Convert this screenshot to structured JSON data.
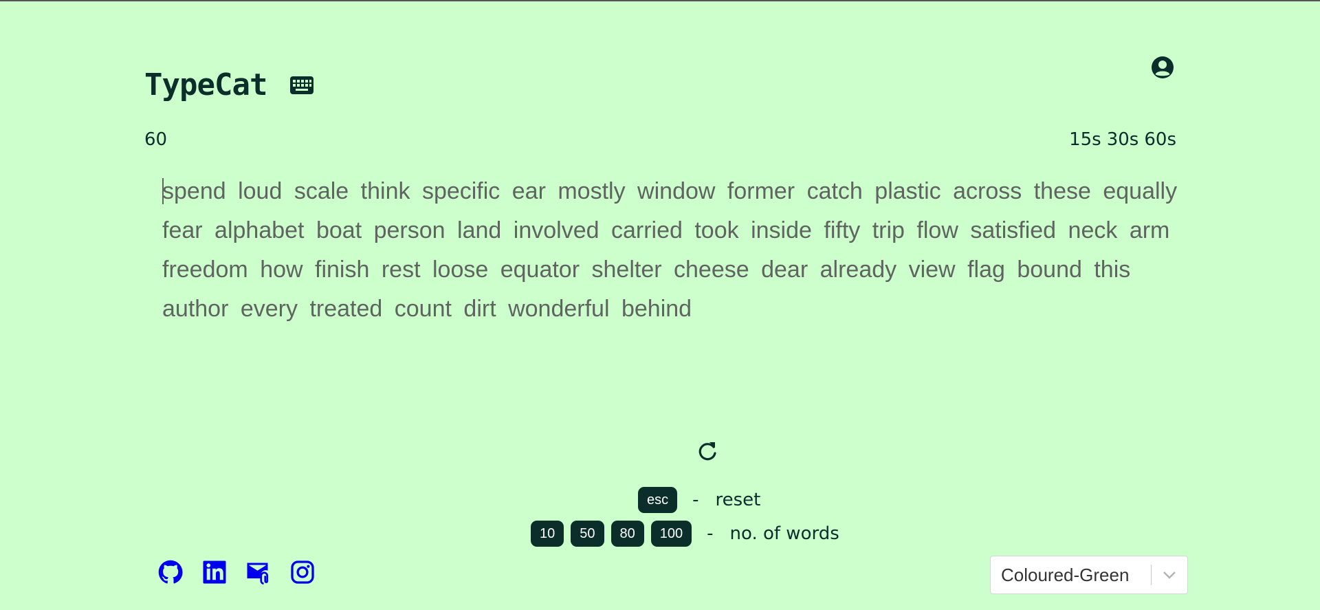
{
  "app": {
    "name": "TypeCat"
  },
  "icons": {
    "keyboard": "keyboard-icon",
    "account": "user-circle-icon",
    "reload": "reload-icon",
    "github": "github-icon",
    "linkedin": "linkedin-icon",
    "mail": "mail-icon",
    "instagram": "instagram-icon",
    "chevron": "chevron-down-icon"
  },
  "colors": {
    "background": "#ccffcc",
    "primary": "#0b2e2a",
    "words": "#5f6460",
    "links": "#0000ee"
  },
  "timer": {
    "value": "60"
  },
  "durations": [
    "15s",
    "30s",
    "60s"
  ],
  "words": [
    "spend",
    "loud",
    "scale",
    "think",
    "specific",
    "ear",
    "mostly",
    "window",
    "former",
    "catch",
    "plastic",
    "across",
    "these",
    "equally",
    "fear",
    "alphabet",
    "boat",
    "person",
    "land",
    "involved",
    "carried",
    "took",
    "inside",
    "fifty",
    "trip",
    "flow",
    "satisfied",
    "neck",
    "arm",
    "freedom",
    "how",
    "finish",
    "rest",
    "loose",
    "equator",
    "shelter",
    "cheese",
    "dear",
    "already",
    "view",
    "flag",
    "bound",
    "this",
    "author",
    "every",
    "treated",
    "count",
    "dirt",
    "wonderful",
    "behind"
  ],
  "hints": {
    "reset": {
      "key": "esc",
      "dash": "-",
      "label": "reset"
    },
    "word_count": {
      "keys": [
        "10",
        "50",
        "80",
        "100"
      ],
      "dash": "-",
      "label": "no. of words"
    }
  },
  "theme": {
    "selected": "Coloured-Green"
  }
}
